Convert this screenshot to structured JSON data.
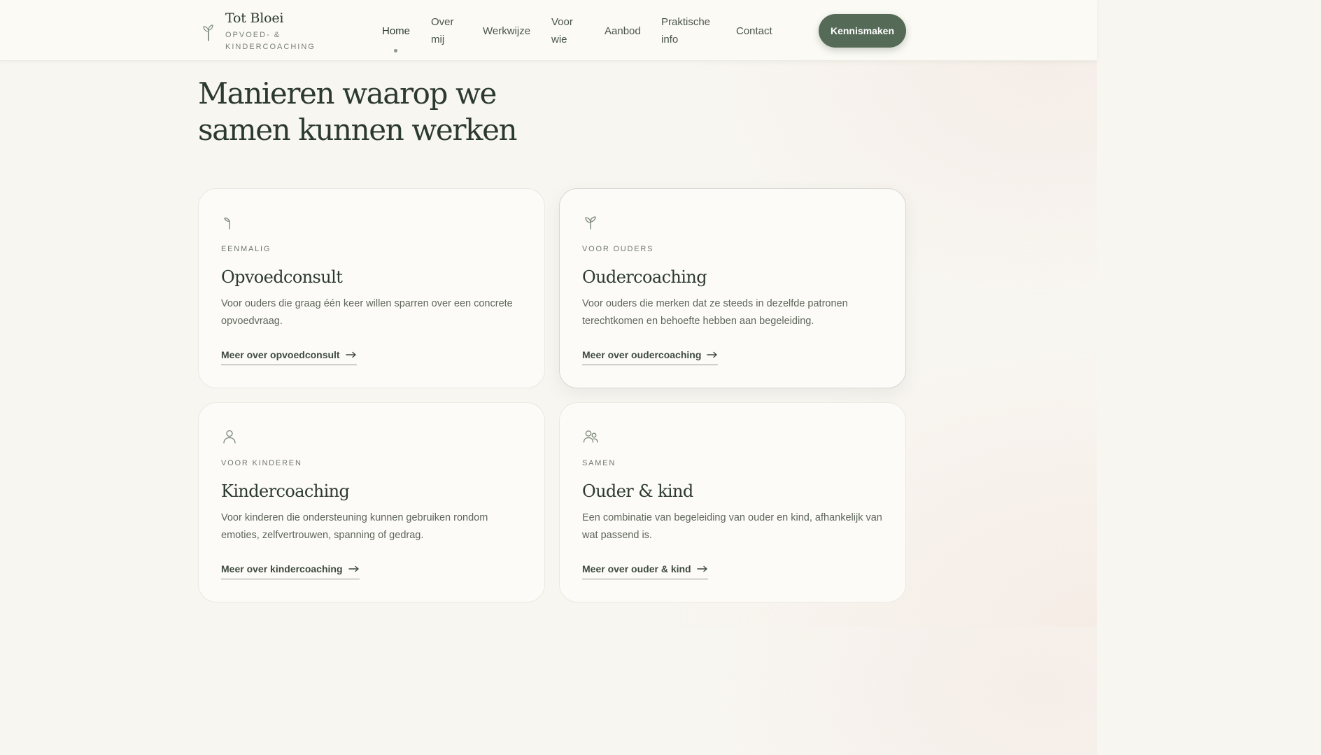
{
  "brand": {
    "name": "Tot Bloei",
    "tagline": "OPVOED- & KINDERCOACHING",
    "logo_icon": "sprout-icon"
  },
  "nav": {
    "items": [
      {
        "label": "Home",
        "active": true
      },
      {
        "label": "Over mij"
      },
      {
        "label": "Werkwijze"
      },
      {
        "label": "Voor wie"
      },
      {
        "label": "Aanbod"
      },
      {
        "label": "Praktische info"
      },
      {
        "label": "Contact"
      }
    ],
    "cta_label": "Kennismaken"
  },
  "section": {
    "title": "Manieren waarop we samen kunnen werken"
  },
  "cards": [
    {
      "icon": "leaf-icon",
      "kicker": "EENMALIG",
      "title": "Opvoedconsult",
      "description": "Voor ouders die graag één keer willen sparren over een concrete opvoedvraag.",
      "link_label": "Meer over opvoedconsult"
    },
    {
      "icon": "sprout-icon",
      "kicker": "VOOR OUDERS",
      "title": "Oudercoaching",
      "description": "Voor ouders die merken dat ze steeds in dezelfde patronen terechtkomen en behoefte hebben aan begeleiding.",
      "link_label": "Meer over oudercoaching"
    },
    {
      "icon": "user-icon",
      "kicker": "VOOR KINDEREN",
      "title": "Kindercoaching",
      "description": "Voor kinderen die ondersteuning kunnen gebruiken rondom emoties, zelfvertrouwen, spanning of gedrag.",
      "link_label": "Meer over kindercoaching"
    },
    {
      "icon": "users-icon",
      "kicker": "SAMEN",
      "title": "Ouder & kind",
      "description": "Een combinatie van begeleiding van ouder en kind, afhankelijk van wat passend is.",
      "link_label": "Meer over ouder & kind"
    }
  ],
  "colors": {
    "accent": "#556a57",
    "heading": "#2c3a2e",
    "body_text": "#5d665b",
    "background": "#f8f6f1",
    "card_background": "#fdfbf7"
  }
}
